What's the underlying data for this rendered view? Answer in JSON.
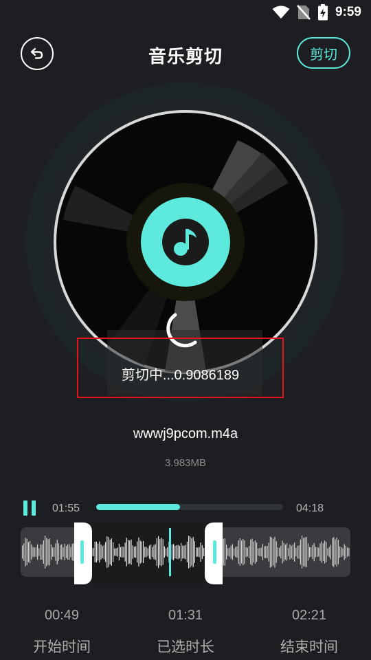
{
  "status_bar": {
    "time": "9:59",
    "icons": [
      "wifi-icon",
      "no-sim-icon",
      "battery-charging-icon"
    ]
  },
  "header": {
    "back_icon": "back-arrow-icon",
    "title": "音乐剪切",
    "cut_label": "剪切"
  },
  "disc": {
    "center_icon": "music-note-icon",
    "spinner_icon": "loading-spinner-icon"
  },
  "loading": {
    "text": "剪切中...0.9086189"
  },
  "file": {
    "name": "wwwj9pcom.m4a",
    "size": "3.983MB"
  },
  "player": {
    "pause_icon": "pause-icon",
    "current_time": "01:55",
    "total_time": "04:18",
    "progress": 0.45
  },
  "selection": {
    "start_value": "00:49",
    "start_label": "开始时间",
    "duration_value": "01:31",
    "duration_label": "已选时长",
    "end_value": "02:21",
    "end_label": "结束时间"
  },
  "colors": {
    "accent": "#5ee9dd",
    "background": "#1d1e21",
    "highlight_box": "#e3141c"
  }
}
